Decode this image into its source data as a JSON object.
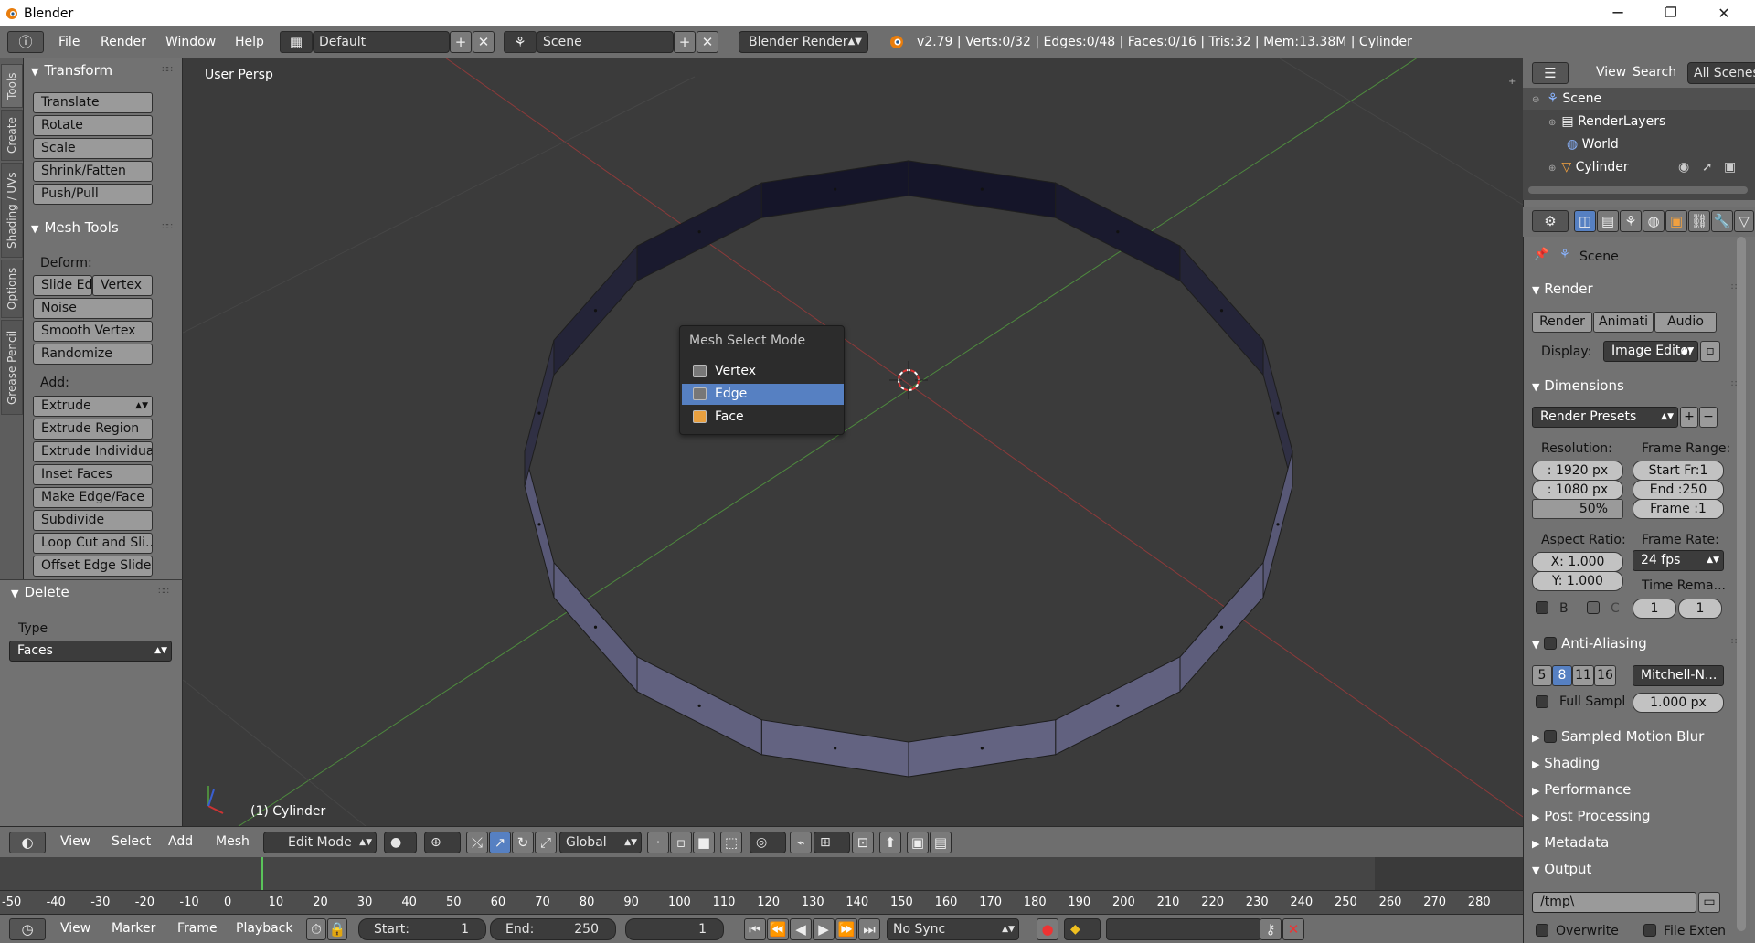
{
  "window": {
    "title": "Blender",
    "minimize": "─",
    "maximize": "❐",
    "close": "✕"
  },
  "topbar": {
    "menus": [
      "File",
      "Render",
      "Window",
      "Help"
    ],
    "screen_layout": "Default",
    "scene": "Scene",
    "render_engine": "Blender Render",
    "stats": "v2.79 | Verts:0/32 | Edges:0/48 | Faces:0/16 | Tris:32 | Mem:13.38M | Cylinder"
  },
  "tool_tabs": [
    "Tools",
    "Create",
    "Shading / UVs",
    "Options",
    "Grease Pencil"
  ],
  "transform_panel": {
    "title": "Transform",
    "buttons": [
      "Translate",
      "Rotate",
      "Scale",
      "Shrink/Fatten",
      "Push/Pull"
    ]
  },
  "mesh_tools_panel": {
    "title": "Mesh Tools",
    "deform_label": "Deform:",
    "slide_edge": "Slide Ed",
    "vertex": "Vertex",
    "deform_buttons": [
      "Noise",
      "Smooth Vertex",
      "Randomize"
    ],
    "add_label": "Add:",
    "extrude": "Extrude",
    "add_buttons": [
      "Extrude Region",
      "Extrude Individual",
      "Inset Faces",
      "Make Edge/Face",
      "Subdivide",
      "Loop Cut and Sli...",
      "Offset Edge Slide"
    ]
  },
  "delete_panel": {
    "title": "Delete",
    "type_label": "Type",
    "type_value": "Faces"
  },
  "viewport": {
    "view_name": "User Persp",
    "object_label": "(1) Cylinder"
  },
  "mesh_select_popup": {
    "title": "Mesh Select Mode",
    "items": [
      "Vertex",
      "Edge",
      "Face"
    ],
    "selected": "Edge"
  },
  "viewport_header": {
    "menus": [
      "View",
      "Select",
      "Add",
      "Mesh"
    ],
    "mode": "Edit Mode",
    "orientation": "Global"
  },
  "timeline": {
    "ticks": [
      "-50",
      "-40",
      "-30",
      "-20",
      "-10",
      "0",
      "10",
      "20",
      "30",
      "40",
      "50",
      "60",
      "70",
      "80",
      "90",
      "100",
      "110",
      "120",
      "130",
      "140",
      "150",
      "160",
      "170",
      "180",
      "190",
      "200",
      "210",
      "220",
      "230",
      "240",
      "250",
      "260",
      "270",
      "280"
    ],
    "current_frame_marker": "0",
    "menus": [
      "View",
      "Marker",
      "Frame",
      "Playback"
    ],
    "start_label": "Start:",
    "start_value": "1",
    "end_label": "End:",
    "end_value": "250",
    "frame_value": "1",
    "sync": "No Sync"
  },
  "outliner": {
    "menus": [
      "View",
      "Search",
      "All Scenes"
    ],
    "items": [
      "Scene",
      "RenderLayers",
      "World",
      "Cylinder"
    ]
  },
  "properties": {
    "context": "Scene",
    "render_panel": "Render",
    "render_buttons": [
      "Render",
      "Animati",
      "Audio"
    ],
    "display_label": "Display:",
    "display_value": "Image Editor",
    "dimensions_panel": "Dimensions",
    "render_presets": "Render Presets",
    "resolution_label": "Resolution:",
    "res_x": ": 1920 px",
    "res_y": ": 1080 px",
    "res_pct": "50%",
    "frame_range_label": "Frame Range:",
    "start_frame": "Start Fr:1",
    "end_frame": "End :250",
    "frame": "Frame :1",
    "aspect_label": "Aspect Ratio:",
    "aspect_x": "X:  1.000",
    "aspect_y": "Y:  1.000",
    "frame_rate_label": "Frame Rate:",
    "fps": "24 fps",
    "time_remap_label": "Time Rema...",
    "time_old": "1",
    "time_new": "1",
    "border_b": "B",
    "crop_c": "C",
    "aa_panel": "Anti-Aliasing",
    "aa_samples": [
      "5",
      "8",
      "11",
      "16"
    ],
    "aa_selected": "8",
    "aa_filter": "Mitchell-N...",
    "full_sample": "Full Sampl",
    "filter_size": "1.000 px",
    "collapsed_panels": [
      "Sampled Motion Blur",
      "Shading",
      "Performance",
      "Post Processing",
      "Metadata"
    ],
    "output_panel": "Output",
    "output_path": "/tmp\\",
    "overwrite": "Overwrite",
    "file_extensions": "File Exten"
  },
  "colors": {
    "accent": "#5680c2",
    "header": "#6e6e6e",
    "panel": "#727272",
    "viewport": "#3b3b3b"
  }
}
